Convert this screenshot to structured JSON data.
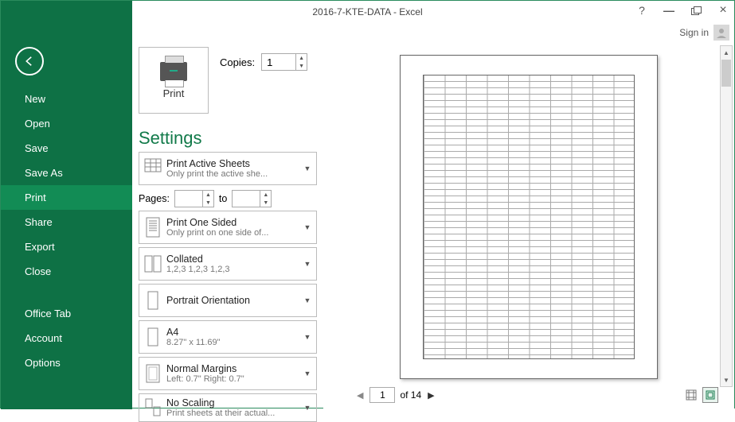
{
  "titlebar": {
    "title": "2016-7-KTE-DATA - Excel",
    "signin": "Sign in"
  },
  "sidebar": {
    "items": [
      {
        "label": "New"
      },
      {
        "label": "Open"
      },
      {
        "label": "Save"
      },
      {
        "label": "Save As"
      },
      {
        "label": "Print"
      },
      {
        "label": "Share"
      },
      {
        "label": "Export"
      },
      {
        "label": "Close"
      }
    ],
    "lower_items": [
      {
        "label": "Office Tab"
      },
      {
        "label": "Account"
      },
      {
        "label": "Options"
      }
    ]
  },
  "print": {
    "button_label": "Print",
    "copies_label": "Copies:",
    "copies_value": "1",
    "settings_title": "Settings",
    "pages_label": "Pages:",
    "pages_to": "to",
    "pages_from": "",
    "pages_until": "",
    "options": {
      "active_sheets": {
        "title": "Print Active Sheets",
        "sub": "Only print the active she..."
      },
      "one_sided": {
        "title": "Print One Sided",
        "sub": "Only print on one side of..."
      },
      "collated": {
        "title": "Collated",
        "sub": "1,2,3   1,2,3   1,2,3"
      },
      "orientation": {
        "title": "Portrait Orientation",
        "sub": ""
      },
      "paper": {
        "title": "A4",
        "sub": "8.27\" x 11.69\""
      },
      "margins": {
        "title": "Normal Margins",
        "sub": "Left:  0.7\"    Right:  0.7\""
      },
      "scaling": {
        "title": "No Scaling",
        "sub": "Print sheets at their actual..."
      }
    }
  },
  "preview": {
    "current_page": "1",
    "total_label": "of 14"
  }
}
